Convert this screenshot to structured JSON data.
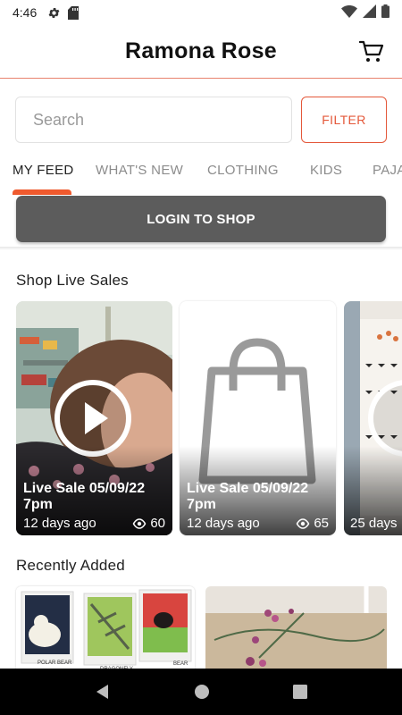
{
  "status_bar": {
    "time": "4:46"
  },
  "header": {
    "title": "Ramona Rose"
  },
  "search": {
    "placeholder": "Search",
    "filter_label": "FILTER"
  },
  "tabs": [
    {
      "label": "MY FEED"
    },
    {
      "label": "WHAT'S NEW"
    },
    {
      "label": "CLOTHING"
    },
    {
      "label": "KIDS"
    },
    {
      "label": "PAJA"
    }
  ],
  "login": {
    "label": "LOGIN TO SHOP"
  },
  "live_sales": {
    "section_title": "Shop Live Sales",
    "cards": [
      {
        "title": "Live Sale 05/09/22 7pm",
        "time_ago": "12 days ago",
        "views": "60"
      },
      {
        "title": "Live Sale 05/09/22 7pm",
        "time_ago": "12 days ago",
        "views": "65"
      },
      {
        "title": "",
        "time_ago": "25 days",
        "views": ""
      }
    ]
  },
  "recently_added": {
    "section_title": "Recently Added",
    "print_labels": [
      "POLAR BEAR",
      "DRAGONFLY",
      "BEAR"
    ]
  },
  "colors": {
    "accent": "#ef5a2e",
    "login_bg": "#5c5c5c",
    "header_rule": "#e8826e"
  }
}
